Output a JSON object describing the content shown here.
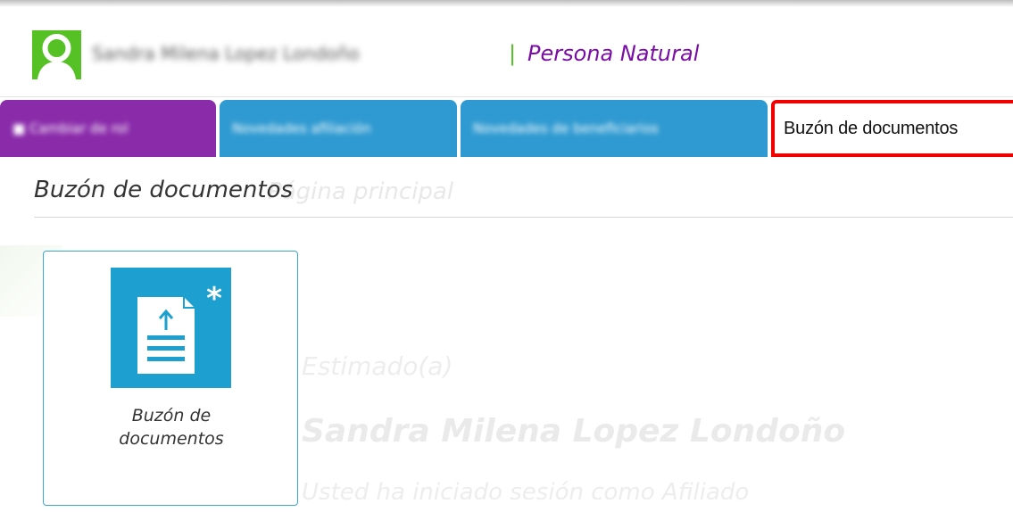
{
  "header": {
    "user_name": "Sandra Milena Lopez Londoño",
    "separator": "|",
    "role": "Persona Natural"
  },
  "tabs": [
    {
      "label": "Cambiar de rol"
    },
    {
      "label": "Novedades afiliación"
    },
    {
      "label": "Novedades de beneficiarios"
    },
    {
      "label": "Buzón de documentos"
    }
  ],
  "breadcrumb": {
    "title": "Buzón de documentos",
    "ghost": "Página principal"
  },
  "card": {
    "line1": "Buzón de",
    "line2": "documentos",
    "badge": "*"
  },
  "welcome": {
    "greeting": "Estimado(a)",
    "name": "Sandra Milena Lopez Londoño",
    "session": "Usted ha iniciado sesión como Afiliado"
  },
  "colors": {
    "accent_green": "#55c125",
    "role_purple": "#7a0da5",
    "tab_purple": "#8a2baa",
    "tab_blue": "#2f9ad1",
    "highlight_red": "#f20000",
    "tile_blue": "#1d9fd0"
  },
  "icons": {
    "avatar": "user-avatar-icon",
    "role_tab": "user-icon",
    "card": "document-upload-icon"
  }
}
